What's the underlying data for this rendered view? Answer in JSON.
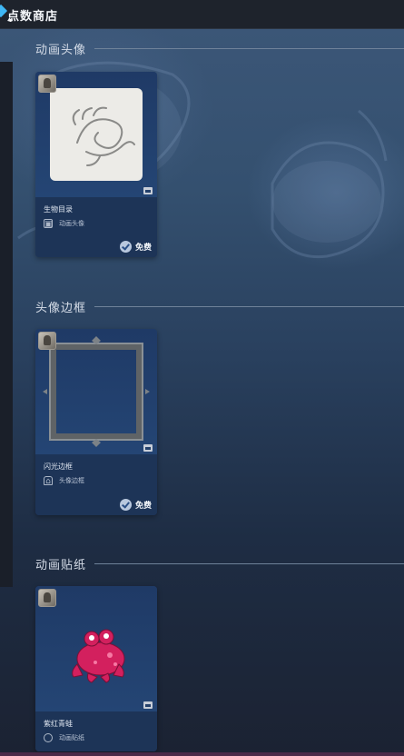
{
  "topbar": {
    "title": "点数商店"
  },
  "sections": [
    {
      "title": "动画头像",
      "item": {
        "name": "生物目录",
        "type": "动画头像",
        "price": "免费"
      }
    },
    {
      "title": "头像边框",
      "item": {
        "name": "闪光边框",
        "type": "头像边框",
        "price": "免费"
      }
    },
    {
      "title": "动画贴纸",
      "item": {
        "name": "紫红青蛙",
        "type": "动画贴纸"
      }
    }
  ],
  "colors": {
    "brand_accent": "#3fb7f5",
    "card_bg": "#223b63",
    "frog": "#d3205e"
  }
}
